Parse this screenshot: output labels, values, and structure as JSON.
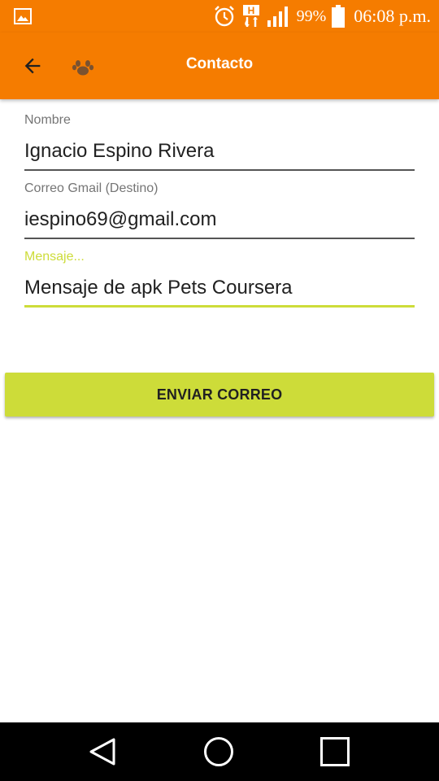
{
  "status_bar": {
    "icons": [
      "gallery-icon",
      "alarm-icon",
      "hspa-data-icon",
      "signal-icon",
      "battery-icon"
    ],
    "battery_percent": "99%",
    "time": "06:08 p.m."
  },
  "app_bar": {
    "back_icon": "arrow-back-icon",
    "logo_icon": "paw-icon",
    "title": "Contacto"
  },
  "form": {
    "name": {
      "label": "Nombre",
      "value": "Ignacio Espino Rivera"
    },
    "email": {
      "label": "Correo Gmail (Destino)",
      "value": "iespino69@gmail.com"
    },
    "message": {
      "label": "Mensaje...",
      "value": "Mensaje de apk Pets Coursera"
    },
    "send_button_label": "ENVIAR CORREO"
  },
  "nav_bar": {
    "icons": [
      "nav-back-icon",
      "nav-home-icon",
      "nav-recents-icon"
    ]
  },
  "colors": {
    "primary": "#f57c00",
    "accent": "#cddc39",
    "nav_background": "#000000"
  }
}
